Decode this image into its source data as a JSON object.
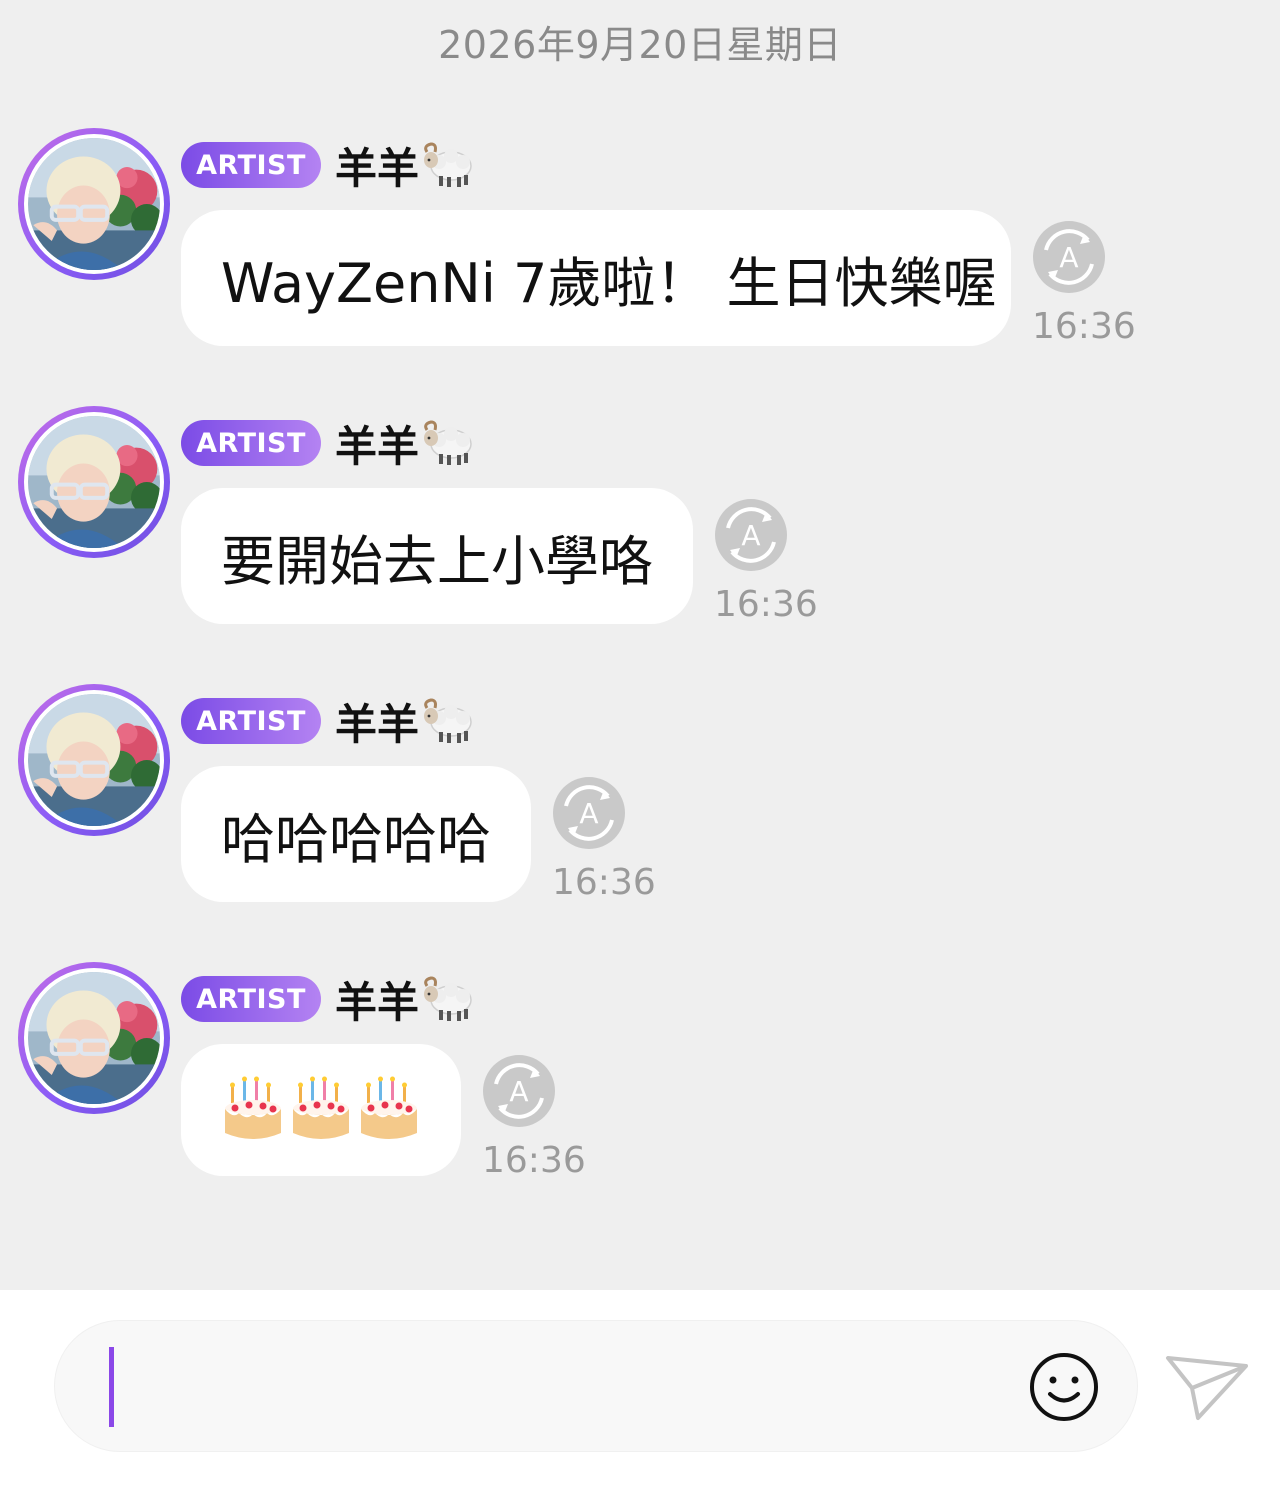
{
  "chat": {
    "date_separator": "2026年9月20日星期日"
  },
  "messages": [
    {
      "badge": "ARTIST",
      "sender": "羊羊",
      "text": "WayZenNi 7歲啦！ 生日快樂喔",
      "time": "16:36"
    },
    {
      "badge": "ARTIST",
      "sender": "羊羊",
      "text": "要開始去上小學咯",
      "time": "16:36"
    },
    {
      "badge": "ARTIST",
      "sender": "羊羊",
      "text": "哈哈哈哈哈",
      "time": "16:36"
    },
    {
      "badge": "ARTIST",
      "sender": "羊羊",
      "emoji": "cake-icon",
      "emoji_count": 3,
      "time": "16:36"
    }
  ],
  "icons": {
    "sender_suffix": "sheep-icon",
    "translate": "translate-icon",
    "emoji_picker": "emoji-icon",
    "send": "send-icon"
  },
  "composer": {
    "placeholder": "",
    "value": ""
  },
  "colors": {
    "background": "#efefef",
    "bubble": "#ffffff",
    "badge_start": "#7b4be6",
    "badge_end": "#b483f2",
    "caret": "#8b48e8",
    "timestamp": "#9a9a9a"
  }
}
